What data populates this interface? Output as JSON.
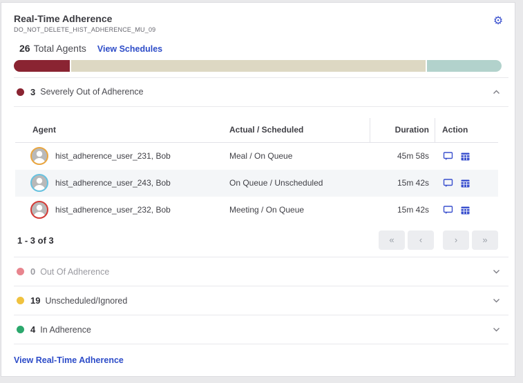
{
  "header": {
    "title": "Real-Time Adherence",
    "subtitle": "DO_NOT_DELETE_HIST_ADHERENCE_MU_09"
  },
  "summary": {
    "total_count": "26",
    "total_label": "Total Agents",
    "view_schedules_link": "View Schedules"
  },
  "chart_data": {
    "type": "bar",
    "title": "Agent adherence distribution (stacked single bar)",
    "categories": [
      "Severely Out of Adherence",
      "Unscheduled/Ignored",
      "In Adherence"
    ],
    "values": [
      3,
      19,
      4
    ],
    "total": 26,
    "segments": [
      {
        "name": "severely-out-of-adherence",
        "count": 3,
        "color": "#8a2432"
      },
      {
        "name": "unscheduled-ignored",
        "count": 19,
        "color": "#ddd8c3"
      },
      {
        "name": "in-adherence",
        "count": 4,
        "color": "#b2d2cc"
      }
    ]
  },
  "sections": [
    {
      "count": "3",
      "label": "Severely Out of Adherence",
      "dot_style": "background:#8a2432",
      "state": "expanded"
    },
    {
      "count": "0",
      "label": "Out Of Adherence",
      "dot_style": "background:#e8858e",
      "state": "collapsed"
    },
    {
      "count": "19",
      "label": "Unscheduled/Ignored",
      "dot_style": "background:#f0c23f",
      "state": "collapsed"
    },
    {
      "count": "4",
      "label": "In Adherence",
      "dot_style": "background:#2ca86d",
      "state": "collapsed"
    }
  ],
  "table": {
    "columns": {
      "agent": "Agent",
      "actual_scheduled": "Actual / Scheduled",
      "duration": "Duration",
      "action": "Action"
    },
    "rows": [
      {
        "agent": "hist_adherence_user_231, Bob",
        "actual_scheduled": "Meal / On Queue",
        "duration": "45m 58s",
        "ring_style": "border-color:#eaa63f"
      },
      {
        "agent": "hist_adherence_user_243, Bob",
        "actual_scheduled": "On Queue / Unscheduled",
        "duration": "15m 42s",
        "ring_style": "border-color:#66c2e0"
      },
      {
        "agent": "hist_adherence_user_232, Bob",
        "actual_scheduled": "Meeting / On Queue",
        "duration": "15m 42s",
        "ring_style": "border-color:#d43a35"
      }
    ]
  },
  "pagination": {
    "label": "1 - 3 of 3",
    "first": "«",
    "prev": "‹",
    "next": "›",
    "last": "»"
  },
  "footer": {
    "view_rta_link": "View Real-Time Adherence"
  },
  "colors": {
    "accent_blue": "#3a50ce",
    "link_blue": "#2d4cc8",
    "severely_maroon": "#8a2432",
    "unscheduled_tan": "#ddd8c3",
    "in_adherence_teal": "#b2d2cc",
    "out_pink": "#e8858e",
    "unscheduled_dot_yellow": "#f0c23f",
    "in_adherence_dot_green": "#2ca86d"
  }
}
